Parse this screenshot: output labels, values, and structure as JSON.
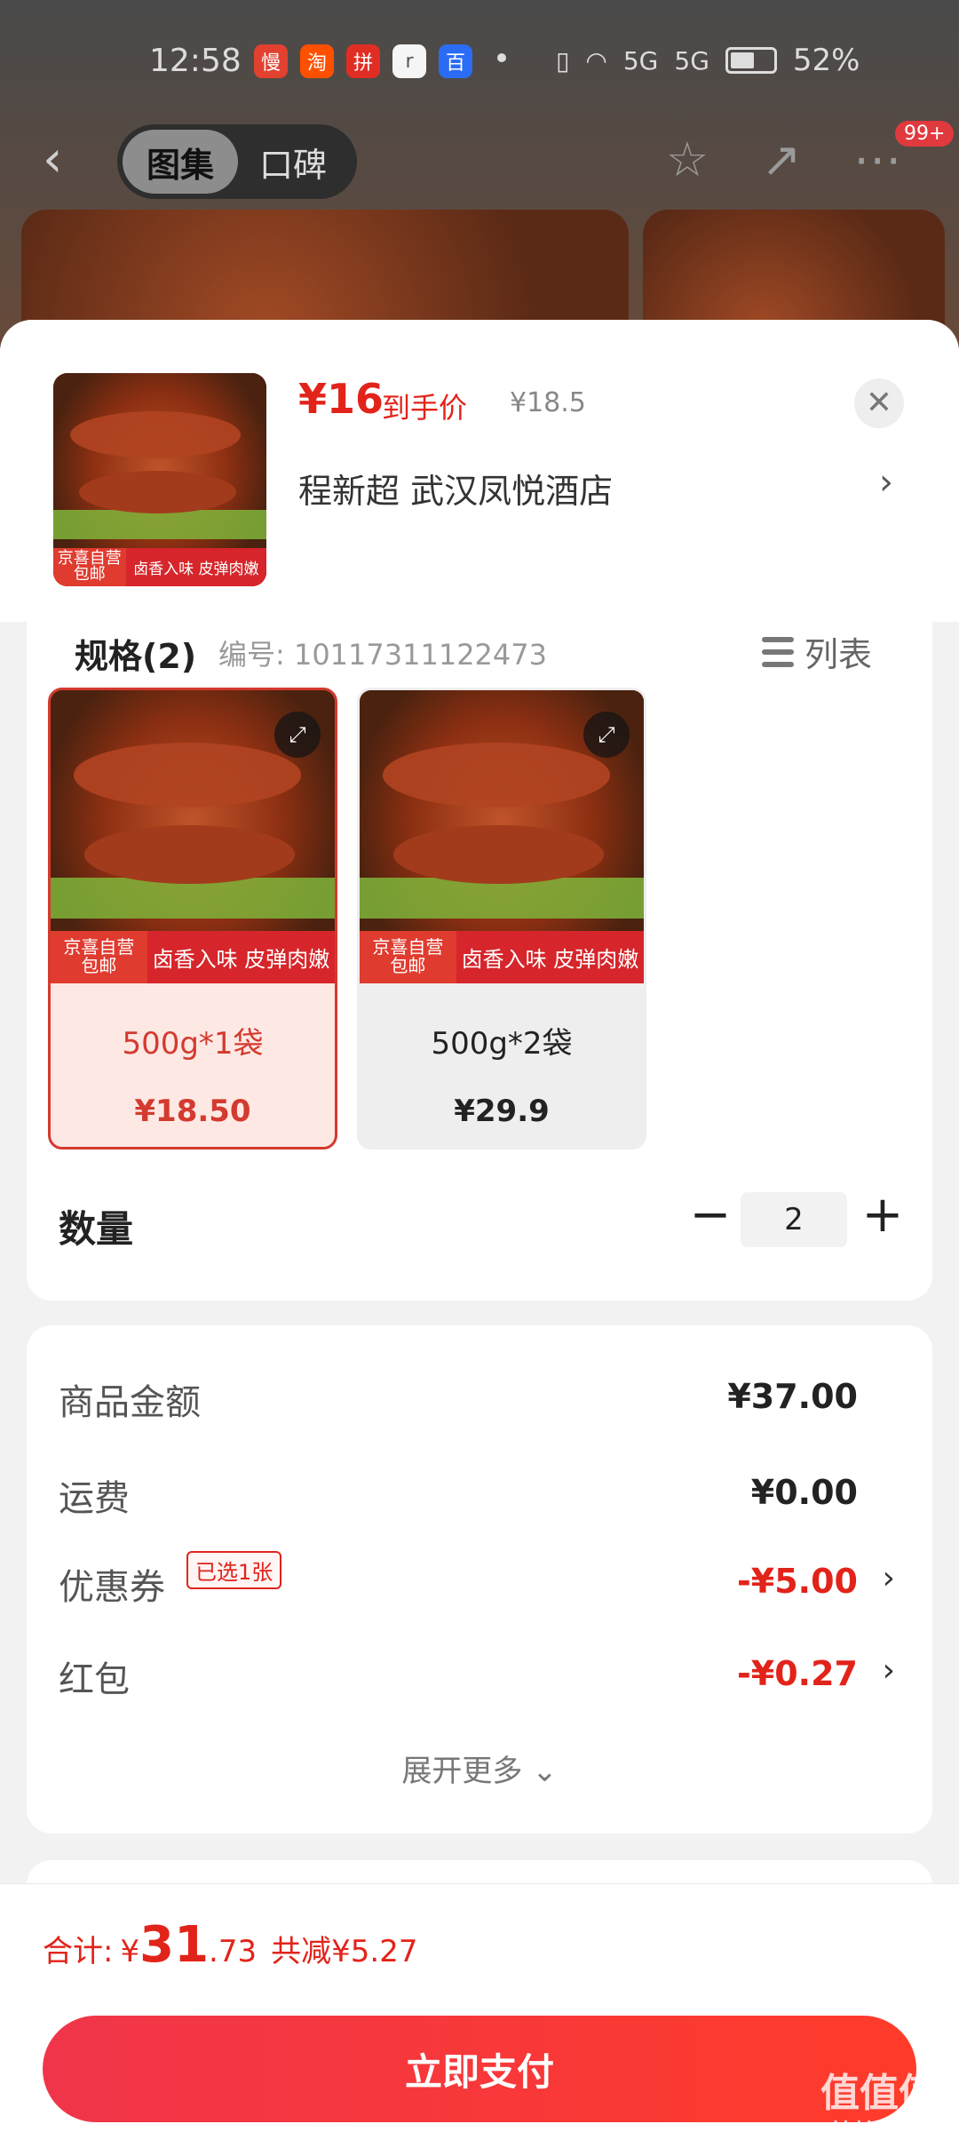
{
  "status": {
    "time": "12:58",
    "apps": [
      {
        "name": "manmanbuy-icon",
        "glyph": "慢",
        "color": "#e2412f"
      },
      {
        "name": "taobao-icon",
        "glyph": "淘",
        "color": "#ff5000"
      },
      {
        "name": "app-icon",
        "glyph": "拼",
        "color": "#e02e24"
      },
      {
        "name": "realme-icon",
        "glyph": "r",
        "color": "#f5f5f5"
      },
      {
        "name": "baidu-icon",
        "glyph": "百",
        "color": "#2b6cf4"
      }
    ],
    "net": "5G",
    "battery": "52%"
  },
  "topbar": {
    "tabs": [
      "图集",
      "口碑"
    ],
    "badge": "99+"
  },
  "product": {
    "price_now": "¥16",
    "price_label": "到手价",
    "price_old": "¥18.5",
    "shop": "程新超  武汉凤悦酒店",
    "tag_left_1": "京喜自营",
    "tag_left_2": "包邮",
    "tag_right": "卤香入味 皮弹肉嫩"
  },
  "spec": {
    "title": "规格(2)",
    "number": "编号: 10117311122473",
    "list_label": "列表",
    "options": [
      {
        "label": "500g*1袋",
        "price": "¥18.50",
        "selected": true
      },
      {
        "label": "500g*2袋",
        "price": "¥29.9",
        "selected": false
      }
    ]
  },
  "quantity": {
    "label": "数量",
    "minus": "−",
    "value": "2",
    "plus": "+"
  },
  "costs": {
    "rows": [
      {
        "label": "商品金额",
        "value": "¥37.00"
      },
      {
        "label": "运费",
        "value": "¥0.00"
      },
      {
        "label": "优惠券",
        "value": "-¥5.00",
        "chip": "已选1张"
      },
      {
        "label": "红包",
        "value": "-¥0.27"
      }
    ],
    "expand_more": "展开更多 ⌄"
  },
  "footer": {
    "total_label": "合计:",
    "total_currency": "¥",
    "total_int": "31",
    "total_dec": ".73",
    "total_reduce": "共减¥5.27",
    "pay_button": "立即支付"
  },
  "watermark": {
    "text": "值值值",
    "domain": "zhizhizhi.com"
  }
}
